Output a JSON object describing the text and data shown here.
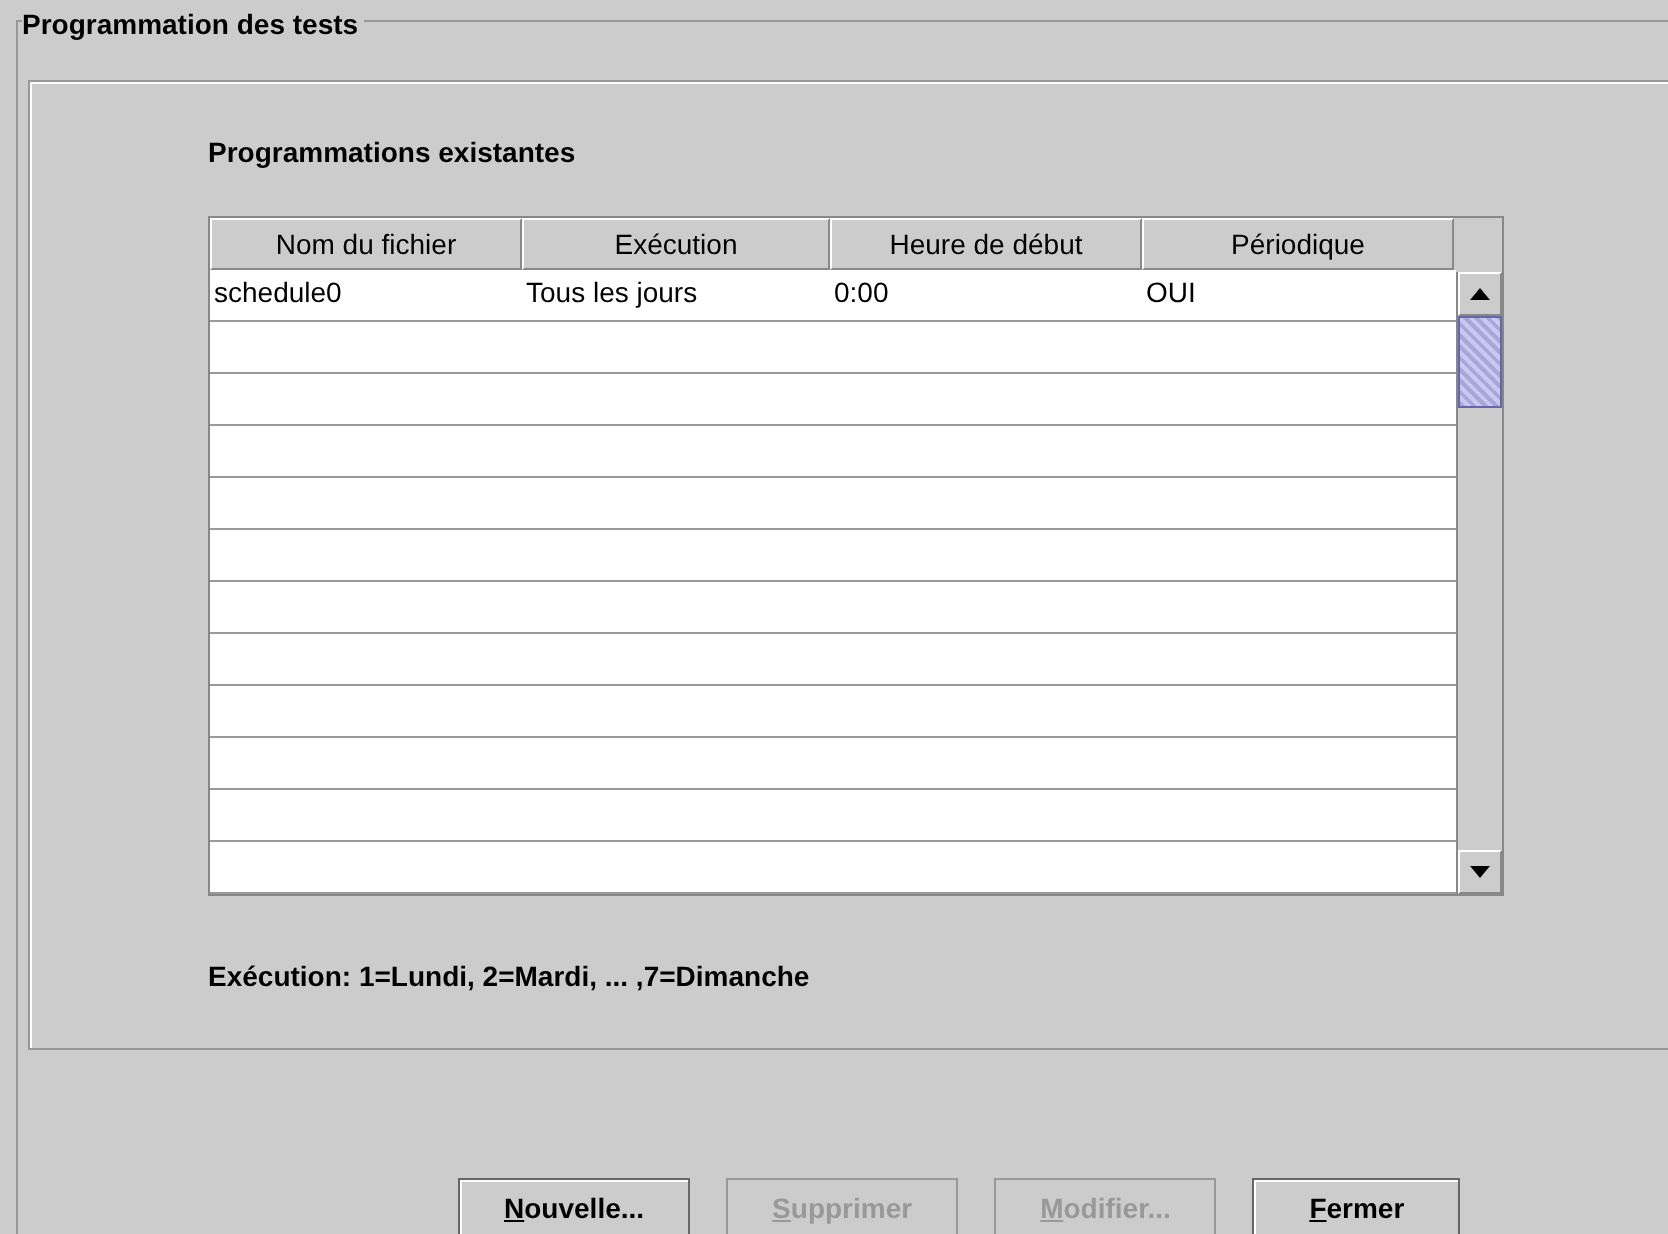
{
  "group": {
    "title": "Programmation des tests"
  },
  "section_title": "Programmations existantes",
  "table": {
    "columns": [
      "Nom du fichier",
      "Exécution",
      "Heure de début",
      "Périodique"
    ],
    "rows": [
      [
        "schedule0",
        "Tous les jours",
        "0:00",
        "OUI"
      ]
    ]
  },
  "legend": "Exécution: 1=Lundi, 2=Mardi, ... ,7=Dimanche",
  "buttons": [
    {
      "label": "Nouvelle...",
      "disabled": false
    },
    {
      "label": "Supprimer",
      "disabled": true
    },
    {
      "label": "Modifier...",
      "disabled": true
    },
    {
      "label": "Fermer",
      "disabled": false
    }
  ]
}
